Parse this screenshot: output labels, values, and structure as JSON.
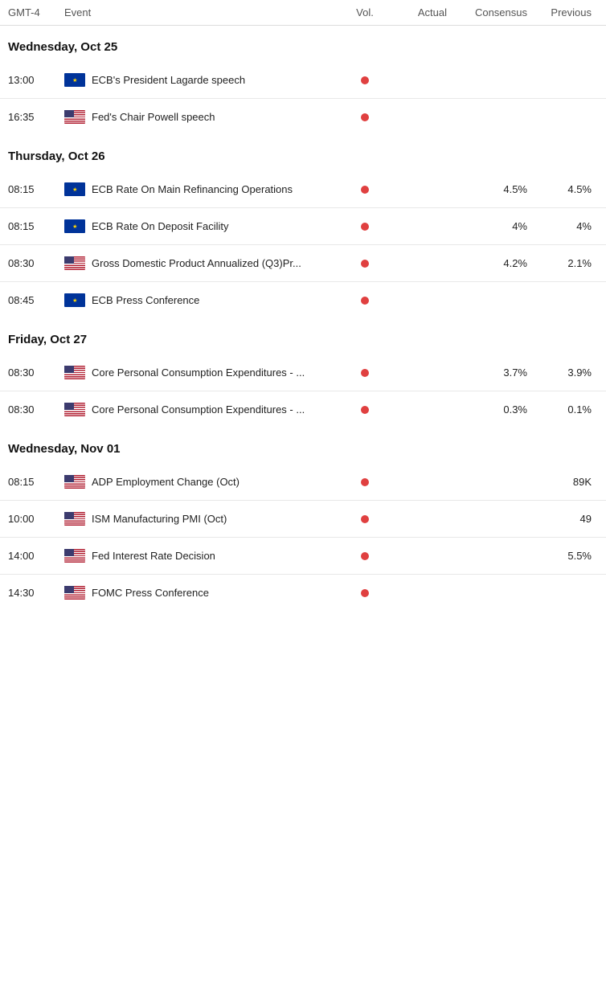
{
  "header": {
    "timezone": "GMT-4",
    "col_event": "Event",
    "col_vol": "Vol.",
    "col_actual": "Actual",
    "col_consensus": "Consensus",
    "col_previous": "Previous"
  },
  "sections": [
    {
      "title": "Wednesday, Oct 25",
      "events": [
        {
          "time": "13:00",
          "flag": "eu",
          "name": "ECB's President Lagarde speech",
          "vol": true,
          "actual": "",
          "consensus": "",
          "previous": ""
        },
        {
          "time": "16:35",
          "flag": "us",
          "name": "Fed's Chair Powell speech",
          "vol": true,
          "actual": "",
          "consensus": "",
          "previous": ""
        }
      ]
    },
    {
      "title": "Thursday, Oct 26",
      "events": [
        {
          "time": "08:15",
          "flag": "eu",
          "name": "ECB Rate On Main Refinancing Operations",
          "vol": true,
          "actual": "",
          "consensus": "4.5%",
          "previous": "4.5%"
        },
        {
          "time": "08:15",
          "flag": "eu",
          "name": "ECB Rate On Deposit Facility",
          "vol": true,
          "actual": "",
          "consensus": "4%",
          "previous": "4%"
        },
        {
          "time": "08:30",
          "flag": "us",
          "name": "Gross Domestic Product Annualized (Q3)Pr...",
          "vol": true,
          "actual": "",
          "consensus": "4.2%",
          "previous": "2.1%"
        },
        {
          "time": "08:45",
          "flag": "eu",
          "name": "ECB Press Conference",
          "vol": true,
          "actual": "",
          "consensus": "",
          "previous": ""
        }
      ]
    },
    {
      "title": "Friday, Oct 27",
      "events": [
        {
          "time": "08:30",
          "flag": "us",
          "name": "Core Personal Consumption Expenditures - ...",
          "vol": true,
          "actual": "",
          "consensus": "3.7%",
          "previous": "3.9%"
        },
        {
          "time": "08:30",
          "flag": "us",
          "name": "Core Personal Consumption Expenditures - ...",
          "vol": true,
          "actual": "",
          "consensus": "0.3%",
          "previous": "0.1%"
        }
      ]
    },
    {
      "title": "Wednesday, Nov 01",
      "events": [
        {
          "time": "08:15",
          "flag": "us",
          "name": "ADP Employment Change (Oct)",
          "vol": true,
          "actual": "",
          "consensus": "",
          "previous": "89K"
        },
        {
          "time": "10:00",
          "flag": "us",
          "name": "ISM Manufacturing PMI (Oct)",
          "vol": true,
          "actual": "",
          "consensus": "",
          "previous": "49"
        },
        {
          "time": "14:00",
          "flag": "us",
          "name": "Fed Interest Rate Decision",
          "vol": true,
          "actual": "",
          "consensus": "",
          "previous": "5.5%"
        },
        {
          "time": "14:30",
          "flag": "us",
          "name": "FOMC Press Conference",
          "vol": true,
          "actual": "",
          "consensus": "",
          "previous": ""
        }
      ]
    }
  ]
}
